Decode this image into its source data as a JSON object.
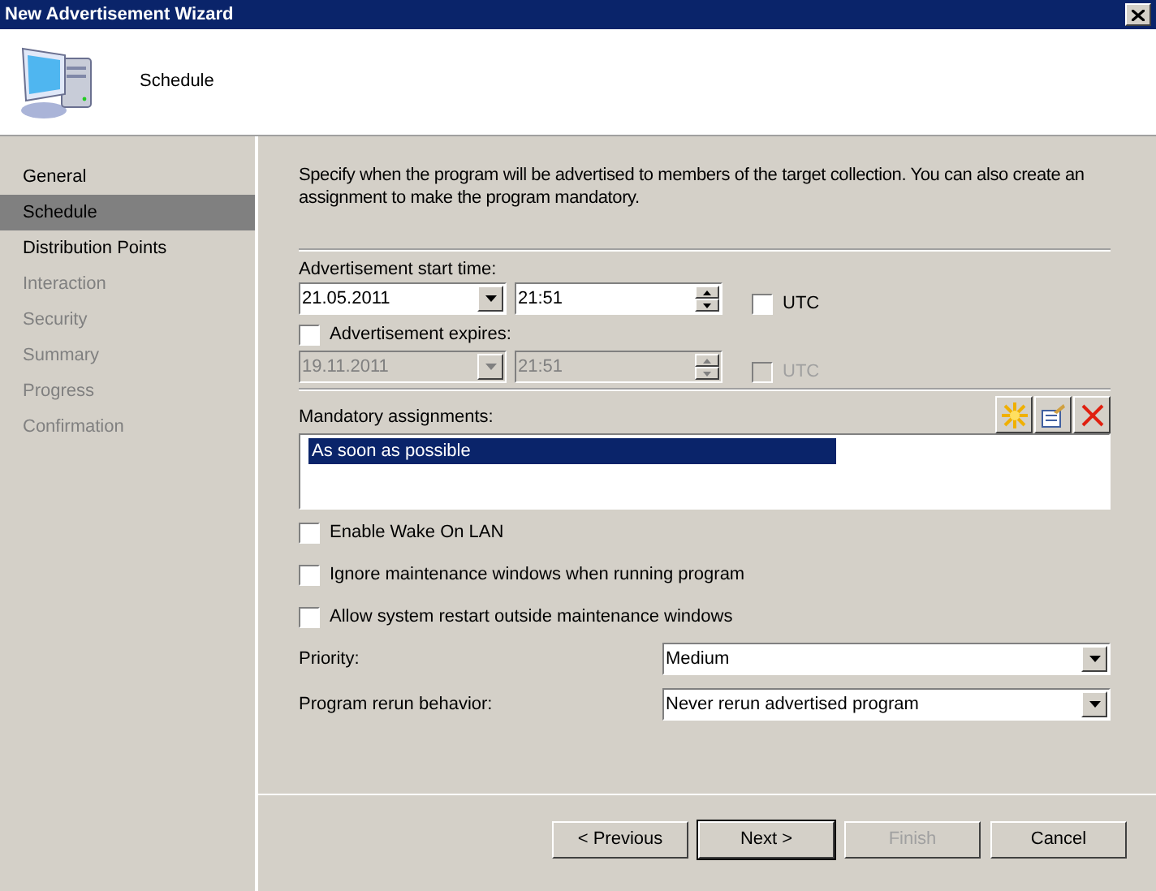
{
  "window": {
    "title": "New Advertisement Wizard"
  },
  "header": {
    "title": "Schedule"
  },
  "sidebar": {
    "items": [
      {
        "label": "General",
        "selected": false,
        "disabled": false
      },
      {
        "label": "Schedule",
        "selected": true,
        "disabled": false
      },
      {
        "label": "Distribution Points",
        "selected": false,
        "disabled": false
      },
      {
        "label": "Interaction",
        "selected": false,
        "disabled": true
      },
      {
        "label": "Security",
        "selected": false,
        "disabled": true
      },
      {
        "label": "Summary",
        "selected": false,
        "disabled": true
      },
      {
        "label": "Progress",
        "selected": false,
        "disabled": true
      },
      {
        "label": "Confirmation",
        "selected": false,
        "disabled": true
      }
    ]
  },
  "description": "Specify when the program will be advertised to members of the target collection. You can also create an assignment to make the program mandatory.",
  "start_time": {
    "label": "Advertisement start time:",
    "date": "21.05.2011",
    "time": "21:51",
    "disabled": false,
    "utc": {
      "label": "UTC",
      "checked": false,
      "disabled": false
    }
  },
  "expires": {
    "label": "Advertisement expires:",
    "checked": false,
    "date": "19.11.2011",
    "time": "21:51",
    "disabled": true,
    "utc": {
      "label": "UTC",
      "checked": false,
      "disabled": true
    }
  },
  "mandatory": {
    "label": "Mandatory assignments:",
    "items": [
      {
        "text": "As soon as possible",
        "selected": true
      }
    ]
  },
  "options": [
    {
      "label": "Enable Wake On LAN",
      "checked": false
    },
    {
      "label": "Ignore maintenance windows when running program",
      "checked": false
    },
    {
      "label": "Allow system restart outside maintenance windows",
      "checked": false
    }
  ],
  "priority": {
    "label": "Priority:",
    "value": "Medium"
  },
  "rerun": {
    "label": "Program rerun behavior:",
    "value": "Never rerun advertised program"
  },
  "buttons": [
    {
      "label": "< Previous",
      "disabled": false,
      "default": false
    },
    {
      "label": "Next >",
      "disabled": false,
      "default": true
    },
    {
      "label": "Finish",
      "disabled": true,
      "default": false
    },
    {
      "label": "Cancel",
      "disabled": false,
      "default": false
    }
  ]
}
